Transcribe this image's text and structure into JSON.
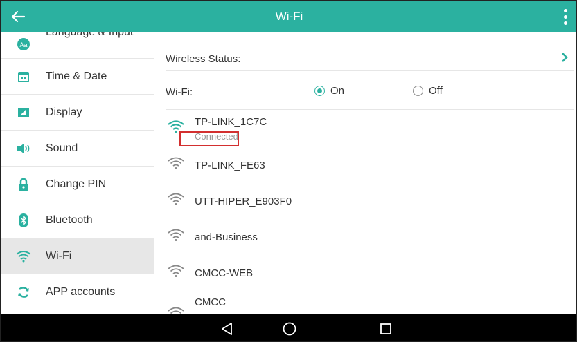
{
  "header": {
    "title": "Wi-Fi"
  },
  "sidebar": {
    "items": [
      {
        "label": "Language & Input",
        "icon": "language-input-icon"
      },
      {
        "label": "Time & Date",
        "icon": "calendar-icon"
      },
      {
        "label": "Display",
        "icon": "display-icon"
      },
      {
        "label": "Sound",
        "icon": "speaker-icon"
      },
      {
        "label": "Change PIN",
        "icon": "lock-icon"
      },
      {
        "label": "Bluetooth",
        "icon": "bluetooth-icon"
      },
      {
        "label": "Wi-Fi",
        "icon": "wifi-icon",
        "active": true
      },
      {
        "label": "APP accounts",
        "icon": "sync-icon"
      }
    ],
    "icon_glyph_language": "Aa"
  },
  "main": {
    "wireless_status_label": "Wireless Status:",
    "wifi_label": "Wi-Fi:",
    "on_label": "On",
    "off_label": "Off",
    "wifi_enabled": true,
    "networks": [
      {
        "name": "TP-LINK_1C7C",
        "status": "Connected",
        "connected": true
      },
      {
        "name": "TP-LINK_FE63"
      },
      {
        "name": "UTT-HIPER_E903F0"
      },
      {
        "name": "and-Business"
      },
      {
        "name": "CMCC-WEB"
      },
      {
        "name": "CMCC",
        "secured": true
      }
    ]
  },
  "colors": {
    "accent": "#2bb1a0",
    "active_bg": "#e7e7e7",
    "highlight_border": "#d32f2f",
    "navbar_bg": "#000000"
  }
}
